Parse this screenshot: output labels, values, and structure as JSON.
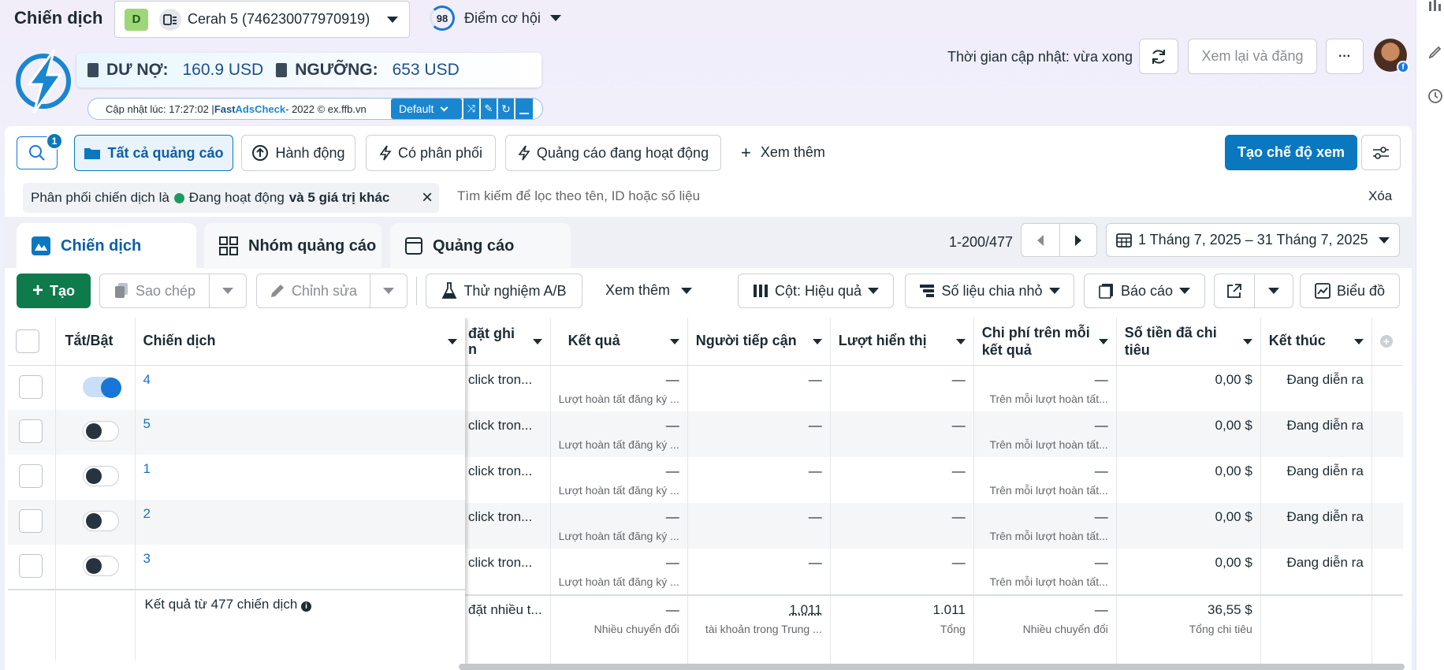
{
  "header": {
    "title": "Chiến dịch",
    "account_initial": "D",
    "account_name": "Cerah 5 (746230077970919)",
    "score": "98",
    "score_label": "Điểm cơ hội",
    "update_time": "Thời gian cập nhật: vừa xong",
    "review_publish": "Xem lại và đăng",
    "more": "···"
  },
  "widget": {
    "debt_label": "DƯ NỢ:",
    "debt_value": "160.9 USD",
    "threshold_label": "NGƯỠNG:",
    "threshold_value": "653 USD",
    "updated_prefix": "Cập nhật lúc: 17:27:02 | ",
    "brand_fast": "Fast ",
    "brand_ads": "AdsCheck",
    "brand_tail": " - 2022 © ex.ffb.vn",
    "preset": "Default"
  },
  "filterbar": {
    "search_badge": "1",
    "all_ads": "Tất cả quảng cáo",
    "actions": "Hành động",
    "delivering": "Có phân phối",
    "active_ads": "Quảng cáo đang hoạt động",
    "see_more": "Xem thêm",
    "create_view": "Tạo chế độ xem"
  },
  "filter": {
    "chip_prefix": "Phân phối chiến dịch là",
    "chip_status": "Đang hoạt động",
    "chip_suffix": "và 5 giá trị khác",
    "search_placeholder": "Tìm kiếm để lọc theo tên, ID hoặc số liệu",
    "clear": "Xóa"
  },
  "tabs": {
    "campaigns": "Chiến dịch",
    "adsets": "Nhóm quảng cáo",
    "ads": "Quảng cáo"
  },
  "pagination": {
    "range": "1-200/477"
  },
  "date_range": "1 Tháng 7, 2025 – 31 Tháng 7, 2025",
  "toolbar": {
    "create": "Tạo",
    "duplicate": "Sao chép",
    "edit": "Chỉnh sửa",
    "ab_test": "Thử nghiệm A/B",
    "see_more": "Xem thêm",
    "columns": "Cột: Hiệu quả",
    "breakdown": "Số liệu chia nhỏ",
    "reports": "Báo cáo",
    "charts": "Biểu đồ"
  },
  "table": {
    "headers": {
      "toggle": "Tắt/Bật",
      "campaign": "Chiến dịch",
      "bid_a": "đặt ghi",
      "bid_b": "n",
      "results": "Kết quả",
      "reach": "Người tiếp cận",
      "impressions": "Lượt hiển thị",
      "cpr_a": "Chi phí trên mỗi",
      "cpr_b": "kết quả",
      "spent_a": "Số tiền đã chi",
      "spent_b": "tiêu",
      "ends": "Kết thúc"
    },
    "rows": [
      {
        "name": "4",
        "bid": "click tron...",
        "result": "—",
        "result_sub": "Lượt hoàn tất đăng ký ...",
        "reach": "—",
        "impr": "—",
        "cpr": "—",
        "cpr_sub": "Trên mỗi lượt hoàn tất...",
        "spent": "0,00 $",
        "ends": "Đang diễn ra",
        "on": true
      },
      {
        "name": "5",
        "bid": "click tron...",
        "result": "—",
        "result_sub": "Lượt hoàn tất đăng ký ...",
        "reach": "—",
        "impr": "—",
        "cpr": "—",
        "cpr_sub": "Trên mỗi lượt hoàn tất...",
        "spent": "0,00 $",
        "ends": "Đang diễn ra",
        "on": false
      },
      {
        "name": "1",
        "bid": "click tron...",
        "result": "—",
        "result_sub": "Lượt hoàn tất đăng ký ...",
        "reach": "—",
        "impr": "—",
        "cpr": "—",
        "cpr_sub": "Trên mỗi lượt hoàn tất...",
        "spent": "0,00 $",
        "ends": "Đang diễn ra",
        "on": false
      },
      {
        "name": "2",
        "bid": "click tron...",
        "result": "—",
        "result_sub": "Lượt hoàn tất đăng ký ...",
        "reach": "—",
        "impr": "—",
        "cpr": "—",
        "cpr_sub": "Trên mỗi lượt hoàn tất...",
        "spent": "0,00 $",
        "ends": "Đang diễn ra",
        "on": false
      },
      {
        "name": "3",
        "bid": "click tron...",
        "result": "—",
        "result_sub": "Lượt hoàn tất đăng ký ...",
        "reach": "—",
        "impr": "—",
        "cpr": "—",
        "cpr_sub": "Trên mỗi lượt hoàn tất...",
        "spent": "0,00 $",
        "ends": "Đang diễn ra",
        "on": false
      }
    ],
    "summary": {
      "label": "Kết quả từ 477 chiến dịch",
      "bid": "đặt nhiều t...",
      "result": "—",
      "result_sub": "Nhiều chuyển đổi",
      "reach": "1.011",
      "reach_sub": "tài khoản trong Trung ...",
      "impr": "1.011",
      "impr_sub": "Tổng",
      "cpr": "—",
      "cpr_sub": "Nhiều chuyển đổi",
      "spent": "36,55 $",
      "spent_sub": "Tổng chi tiêu"
    }
  },
  "colors": {
    "primary": "#0a78be",
    "link": "#1670cc",
    "active": "#1b9b5e",
    "create_green": "#0f7a4b"
  }
}
